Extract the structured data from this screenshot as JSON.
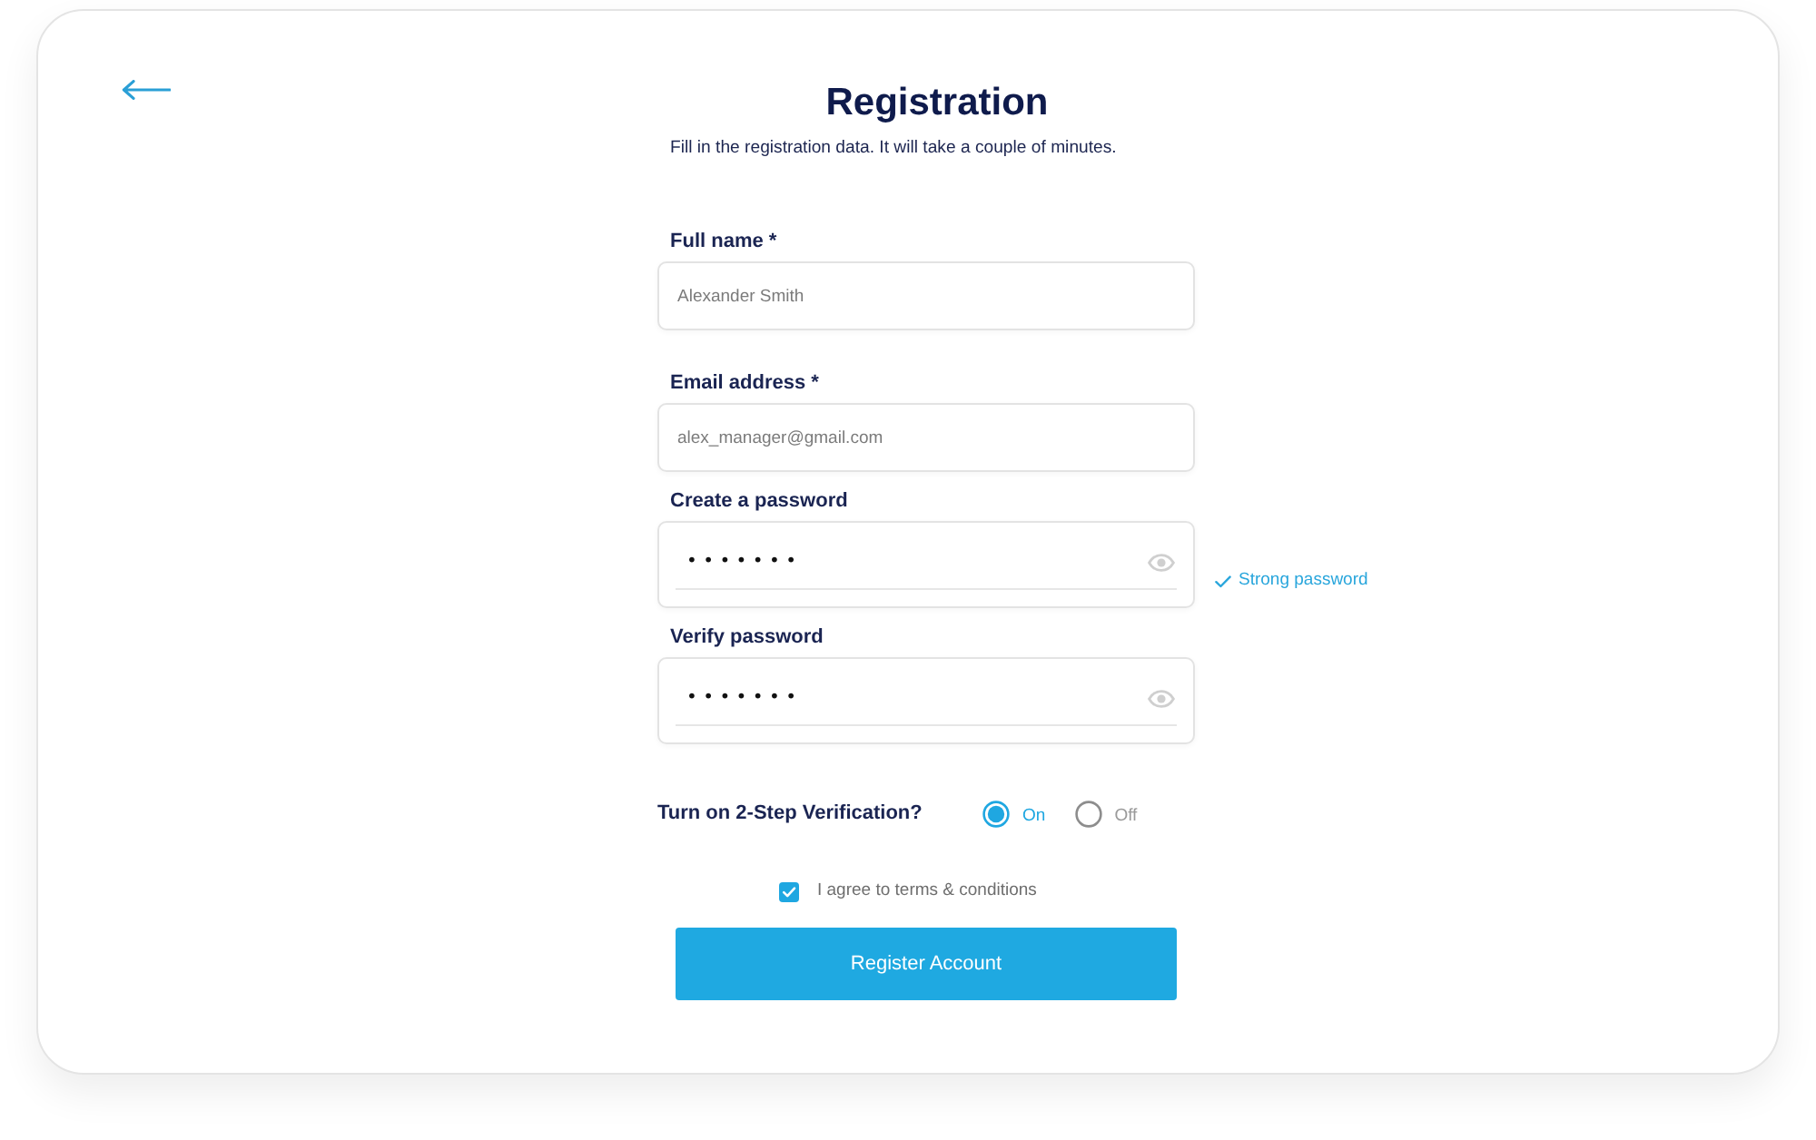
{
  "title": "Registration",
  "subtitle": "Fill in the registration data. It will take a couple of minutes.",
  "fields": [
    {
      "kind": "text",
      "label": "Full name *",
      "placeholder": "Alexander Smith"
    },
    {
      "kind": "text",
      "label": "Email address *",
      "placeholder": "alex_manager@gmail.com"
    },
    {
      "kind": "password",
      "label": "Create a password",
      "value": "•••••••",
      "hint": "Strong password"
    },
    {
      "kind": "password",
      "label": "Verify password",
      "value": "•••••••"
    }
  ],
  "two_step": {
    "label": "Turn on 2-Step Verification?",
    "options": [
      {
        "label": "On",
        "selected": true
      },
      {
        "label": "Off",
        "selected": false
      }
    ]
  },
  "terms": {
    "label": "I agree to terms & conditions",
    "checked": true
  },
  "submit_button": "Register Account"
}
